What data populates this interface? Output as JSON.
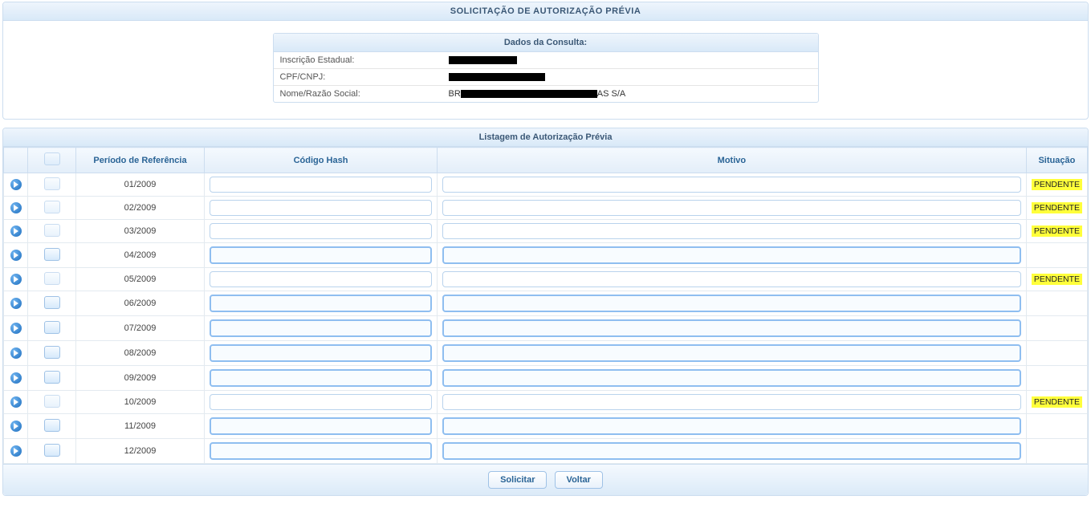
{
  "header": {
    "title": "SOLICITAÇÃO DE AUTORIZAÇÃO PRÉVIA"
  },
  "consulta": {
    "title": "Dados da Consulta:",
    "fields": [
      {
        "label": "Inscrição Estadual:",
        "value": "",
        "redacted": true,
        "redact_width": 85
      },
      {
        "label": "CPF/CNPJ:",
        "value": "",
        "redacted": true,
        "redact_width": 120
      },
      {
        "label": "Nome/Razão Social:",
        "value": "S/A",
        "prefix": "BR",
        "redacted_mid": true,
        "redact_width": 170,
        "suffix": "AS S/A"
      }
    ]
  },
  "listagem": {
    "title": "Listagem de Autorização Prévia",
    "columns": {
      "periodo": "Período de Referência",
      "hash": "Código Hash",
      "motivo": "Motivo",
      "situacao": "Situação"
    },
    "rows": [
      {
        "periodo": "01/2009",
        "hash": "",
        "motivo": "",
        "situacao": "PENDENTE",
        "checked": false,
        "highlight": false
      },
      {
        "periodo": "02/2009",
        "hash": "",
        "motivo": "",
        "situacao": "PENDENTE",
        "checked": false,
        "highlight": false
      },
      {
        "periodo": "03/2009",
        "hash": "",
        "motivo": "",
        "situacao": "PENDENTE",
        "checked": false,
        "highlight": false
      },
      {
        "periodo": "04/2009",
        "hash": "",
        "motivo": "",
        "situacao": "",
        "checked": true,
        "highlight": true
      },
      {
        "periodo": "05/2009",
        "hash": "",
        "motivo": "",
        "situacao": "PENDENTE",
        "checked": false,
        "highlight": false
      },
      {
        "periodo": "06/2009",
        "hash": "",
        "motivo": "",
        "situacao": "",
        "checked": true,
        "highlight": true
      },
      {
        "periodo": "07/2009",
        "hash": "",
        "motivo": "",
        "situacao": "",
        "checked": true,
        "highlight": true
      },
      {
        "periodo": "08/2009",
        "hash": "",
        "motivo": "",
        "situacao": "",
        "checked": true,
        "highlight": true
      },
      {
        "periodo": "09/2009",
        "hash": "",
        "motivo": "",
        "situacao": "",
        "checked": true,
        "highlight": true
      },
      {
        "periodo": "10/2009",
        "hash": "",
        "motivo": "",
        "situacao": "PENDENTE",
        "checked": false,
        "highlight": false
      },
      {
        "periodo": "11/2009",
        "hash": "",
        "motivo": "",
        "situacao": "",
        "checked": true,
        "highlight": true
      },
      {
        "periodo": "12/2009",
        "hash": "",
        "motivo": "",
        "situacao": "",
        "checked": true,
        "highlight": true
      }
    ]
  },
  "buttons": {
    "solicitar": "Solicitar",
    "voltar": "Voltar"
  }
}
